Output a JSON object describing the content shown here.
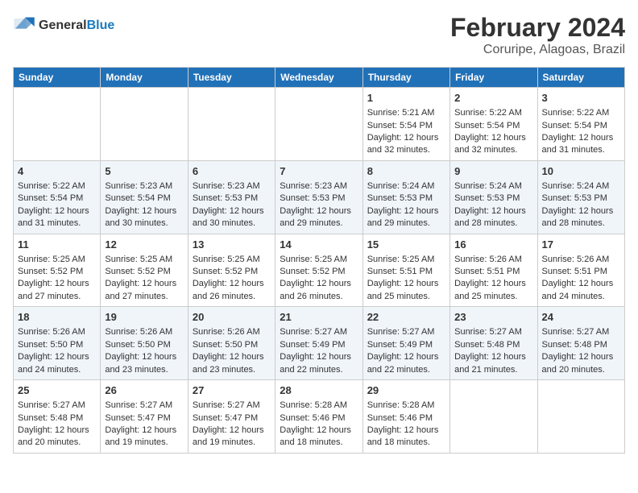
{
  "header": {
    "logo_general": "General",
    "logo_blue": "Blue",
    "month_title": "February 2024",
    "location": "Coruripe, Alagoas, Brazil"
  },
  "weekdays": [
    "Sunday",
    "Monday",
    "Tuesday",
    "Wednesday",
    "Thursday",
    "Friday",
    "Saturday"
  ],
  "weeks": [
    [
      {
        "day": "",
        "content": ""
      },
      {
        "day": "",
        "content": ""
      },
      {
        "day": "",
        "content": ""
      },
      {
        "day": "",
        "content": ""
      },
      {
        "day": "1",
        "content": "Sunrise: 5:21 AM\nSunset: 5:54 PM\nDaylight: 12 hours and 32 minutes."
      },
      {
        "day": "2",
        "content": "Sunrise: 5:22 AM\nSunset: 5:54 PM\nDaylight: 12 hours and 32 minutes."
      },
      {
        "day": "3",
        "content": "Sunrise: 5:22 AM\nSunset: 5:54 PM\nDaylight: 12 hours and 31 minutes."
      }
    ],
    [
      {
        "day": "4",
        "content": "Sunrise: 5:22 AM\nSunset: 5:54 PM\nDaylight: 12 hours and 31 minutes."
      },
      {
        "day": "5",
        "content": "Sunrise: 5:23 AM\nSunset: 5:54 PM\nDaylight: 12 hours and 30 minutes."
      },
      {
        "day": "6",
        "content": "Sunrise: 5:23 AM\nSunset: 5:53 PM\nDaylight: 12 hours and 30 minutes."
      },
      {
        "day": "7",
        "content": "Sunrise: 5:23 AM\nSunset: 5:53 PM\nDaylight: 12 hours and 29 minutes."
      },
      {
        "day": "8",
        "content": "Sunrise: 5:24 AM\nSunset: 5:53 PM\nDaylight: 12 hours and 29 minutes."
      },
      {
        "day": "9",
        "content": "Sunrise: 5:24 AM\nSunset: 5:53 PM\nDaylight: 12 hours and 28 minutes."
      },
      {
        "day": "10",
        "content": "Sunrise: 5:24 AM\nSunset: 5:53 PM\nDaylight: 12 hours and 28 minutes."
      }
    ],
    [
      {
        "day": "11",
        "content": "Sunrise: 5:25 AM\nSunset: 5:52 PM\nDaylight: 12 hours and 27 minutes."
      },
      {
        "day": "12",
        "content": "Sunrise: 5:25 AM\nSunset: 5:52 PM\nDaylight: 12 hours and 27 minutes."
      },
      {
        "day": "13",
        "content": "Sunrise: 5:25 AM\nSunset: 5:52 PM\nDaylight: 12 hours and 26 minutes."
      },
      {
        "day": "14",
        "content": "Sunrise: 5:25 AM\nSunset: 5:52 PM\nDaylight: 12 hours and 26 minutes."
      },
      {
        "day": "15",
        "content": "Sunrise: 5:25 AM\nSunset: 5:51 PM\nDaylight: 12 hours and 25 minutes."
      },
      {
        "day": "16",
        "content": "Sunrise: 5:26 AM\nSunset: 5:51 PM\nDaylight: 12 hours and 25 minutes."
      },
      {
        "day": "17",
        "content": "Sunrise: 5:26 AM\nSunset: 5:51 PM\nDaylight: 12 hours and 24 minutes."
      }
    ],
    [
      {
        "day": "18",
        "content": "Sunrise: 5:26 AM\nSunset: 5:50 PM\nDaylight: 12 hours and 24 minutes."
      },
      {
        "day": "19",
        "content": "Sunrise: 5:26 AM\nSunset: 5:50 PM\nDaylight: 12 hours and 23 minutes."
      },
      {
        "day": "20",
        "content": "Sunrise: 5:26 AM\nSunset: 5:50 PM\nDaylight: 12 hours and 23 minutes."
      },
      {
        "day": "21",
        "content": "Sunrise: 5:27 AM\nSunset: 5:49 PM\nDaylight: 12 hours and 22 minutes."
      },
      {
        "day": "22",
        "content": "Sunrise: 5:27 AM\nSunset: 5:49 PM\nDaylight: 12 hours and 22 minutes."
      },
      {
        "day": "23",
        "content": "Sunrise: 5:27 AM\nSunset: 5:48 PM\nDaylight: 12 hours and 21 minutes."
      },
      {
        "day": "24",
        "content": "Sunrise: 5:27 AM\nSunset: 5:48 PM\nDaylight: 12 hours and 20 minutes."
      }
    ],
    [
      {
        "day": "25",
        "content": "Sunrise: 5:27 AM\nSunset: 5:48 PM\nDaylight: 12 hours and 20 minutes."
      },
      {
        "day": "26",
        "content": "Sunrise: 5:27 AM\nSunset: 5:47 PM\nDaylight: 12 hours and 19 minutes."
      },
      {
        "day": "27",
        "content": "Sunrise: 5:27 AM\nSunset: 5:47 PM\nDaylight: 12 hours and 19 minutes."
      },
      {
        "day": "28",
        "content": "Sunrise: 5:28 AM\nSunset: 5:46 PM\nDaylight: 12 hours and 18 minutes."
      },
      {
        "day": "29",
        "content": "Sunrise: 5:28 AM\nSunset: 5:46 PM\nDaylight: 12 hours and 18 minutes."
      },
      {
        "day": "",
        "content": ""
      },
      {
        "day": "",
        "content": ""
      }
    ]
  ]
}
